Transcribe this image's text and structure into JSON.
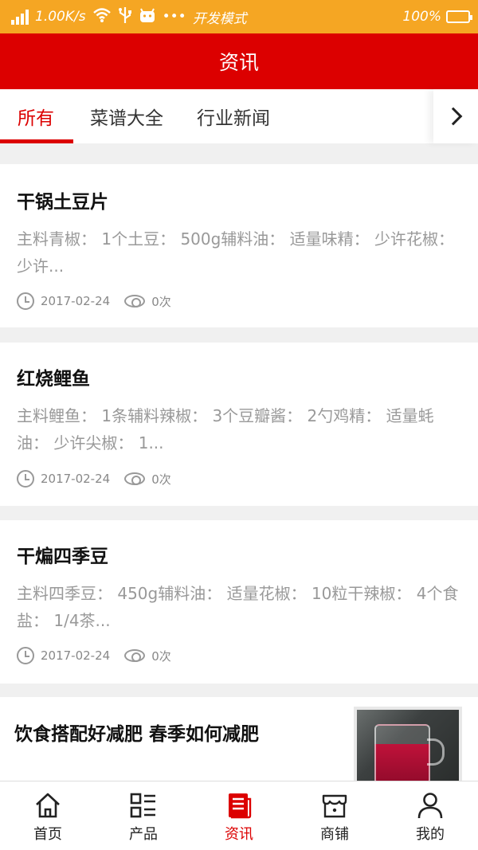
{
  "status_bar": {
    "network_speed": "1.00K/s",
    "dots": "•••",
    "dev_mode": "开发模式",
    "battery": "100%",
    "icons": [
      "signal-icon",
      "wifi-icon",
      "usb-icon",
      "android-icon",
      "battery-icon"
    ]
  },
  "header": {
    "title": "资讯"
  },
  "tabs": [
    {
      "label": "所有",
      "active": true
    },
    {
      "label": "菜谱大全",
      "active": false
    },
    {
      "label": "行业新闻",
      "active": false
    }
  ],
  "articles": [
    {
      "title": "干锅土豆片",
      "summary": "主料青椒： 1个土豆： 500g辅料油： 适量味精： 少许花椒： 少许...",
      "date": "2017-02-24",
      "views": "0次"
    },
    {
      "title": "红烧鲤鱼",
      "summary": "主料鲤鱼： 1条辅料辣椒： 3个豆瓣酱： 2勺鸡精： 适量蚝油： 少许尖椒： 1...",
      "date": "2017-02-24",
      "views": "0次"
    },
    {
      "title": "干煸四季豆",
      "summary": "主料四季豆： 450g辅料油： 适量花椒： 10粒干辣椒： 4个食盐： 1/4茶...",
      "date": "2017-02-24",
      "views": "0次"
    },
    {
      "title": "饮食搭配好减肥 春季如何减肥"
    }
  ],
  "bottom_nav": [
    {
      "label": "首页",
      "icon": "home-icon",
      "active": false
    },
    {
      "label": "产品",
      "icon": "grid-list-icon",
      "active": false
    },
    {
      "label": "资讯",
      "icon": "news-icon",
      "active": true
    },
    {
      "label": "商铺",
      "icon": "shop-icon",
      "active": false
    },
    {
      "label": "我的",
      "icon": "user-icon",
      "active": false
    }
  ],
  "colors": {
    "brand_red": "#dc0000",
    "status_orange": "#f5a623"
  }
}
